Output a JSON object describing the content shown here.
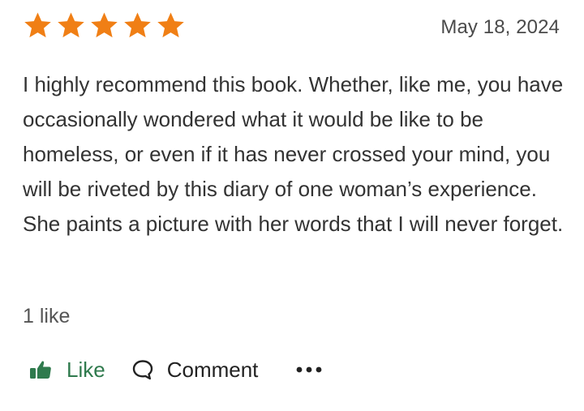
{
  "review": {
    "rating": 5,
    "rating_max": 5,
    "star_color": "#f07f15",
    "date": "May 18, 2024",
    "text": "I highly recommend this book. Whether, like me, you have occasionally wondered what it would be like to be homeless, or even if it has never crossed your mind, you will be riveted by this diary of one woman’s experience. She paints a picture with her words that I will never forget.",
    "likes_count": "1 like"
  },
  "actions": {
    "like_label": "Like",
    "like_icon": "thumbs-up-icon",
    "like_color": "#2f7a4d",
    "comment_label": "Comment",
    "comment_icon": "speech-bubble-icon",
    "more_icon": "ellipsis-icon"
  }
}
